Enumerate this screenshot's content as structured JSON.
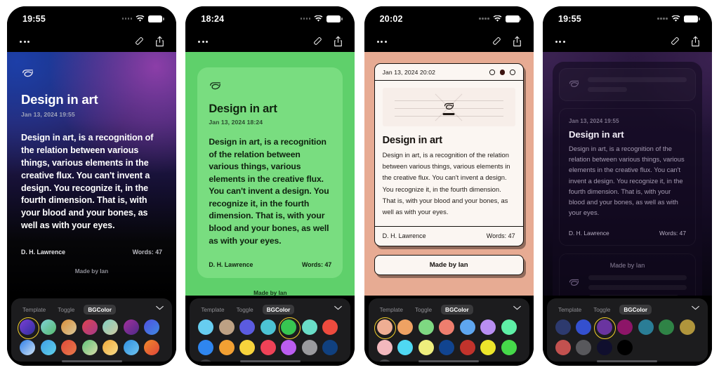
{
  "app": {
    "note_title": "Design in art",
    "author": "D. H. Lawrence",
    "words": "Words: 47",
    "made_by": "Made by Ian",
    "body_text": "Design in art, is a recognition of the relation between various things, various elements in the creative flux. You can't invent a design. You recognize it, in the fourth dimension. That is, with your blood and your bones, as well as with your eyes.",
    "leaf_icon": "leaf-icon",
    "more_icon": "more-icon",
    "eraser_icon": "eraser-icon",
    "share_icon": "share-icon",
    "wifi_icon": "wifi-icon",
    "battery_icon": "battery-icon",
    "signal_icon": "signal-icon",
    "chevron_icon": "chevron-down-icon"
  },
  "panel": {
    "tab_template": "Template",
    "tab_toggle": "Toggle",
    "tab_bgcolor": "BGColor",
    "active_tab": "BGColor",
    "selection_ring_color": "#f3d02b"
  },
  "phones": [
    {
      "id": "phone-gradient",
      "time": "19:55",
      "date": "Jan 13, 2024 19:55",
      "style": "gradient",
      "bg_accent": "#2b2060",
      "swatches": [
        {
          "name": "purple-blue-gradient",
          "css": "linear-gradient(135deg,#7a3fd4,#2f2f9e)",
          "selected": true
        },
        {
          "name": "teal-green-gradient",
          "css": "linear-gradient(135deg,#7fd3d8,#58b96e)",
          "selected": false
        },
        {
          "name": "orange-tan-gradient",
          "css": "linear-gradient(135deg,#d98f3a,#d9c79a)",
          "selected": false
        },
        {
          "name": "red-pink-gradient",
          "css": "linear-gradient(135deg,#e0434f,#a43a8a)",
          "selected": false
        },
        {
          "name": "mint-sand-gradient",
          "css": "linear-gradient(135deg,#7fcfc3,#cfc9a0)",
          "selected": false
        },
        {
          "name": "magenta-purple-gradient",
          "css": "linear-gradient(135deg,#a4309b,#4d2a8a)",
          "selected": false
        },
        {
          "name": "indigo-blue-gradient",
          "css": "linear-gradient(135deg,#4f4fe0,#3f8ae0)",
          "selected": false
        },
        {
          "name": "blue-white-gradient",
          "css": "linear-gradient(135deg,#2f7fe8,#cfe3f5)",
          "selected": false
        },
        {
          "name": "sky-blue-gradient",
          "css": "linear-gradient(135deg,#3f9fe8,#5fd0e8)",
          "selected": false
        },
        {
          "name": "red-orange-gradient",
          "css": "linear-gradient(135deg,#e04a3a,#e87a4a)",
          "selected": false
        },
        {
          "name": "green-cream-gradient",
          "css": "linear-gradient(135deg,#5fc27a,#d8dba8)",
          "selected": false
        },
        {
          "name": "yellow-gradient",
          "css": "linear-gradient(135deg,#f0a83a,#f7dc8a)",
          "selected": false
        },
        {
          "name": "azure-gradient",
          "css": "linear-gradient(135deg,#2f8fe0,#6fc4ef)",
          "selected": false
        },
        {
          "name": "orange-red-gradient",
          "css": "linear-gradient(135deg,#f08a2a,#e0453a)",
          "selected": false
        }
      ]
    },
    {
      "id": "phone-green",
      "time": "18:24",
      "date": "Jan 13, 2024 18:24",
      "style": "green-card",
      "bg_accent": "#5fd06b",
      "swatches": [
        {
          "name": "light-blue",
          "css": "#67cdf0",
          "selected": false
        },
        {
          "name": "tan",
          "css": "#bda184",
          "selected": false
        },
        {
          "name": "indigo",
          "css": "#5b5be0",
          "selected": false
        },
        {
          "name": "teal",
          "css": "#4cc3d4",
          "selected": false
        },
        {
          "name": "green",
          "css": "#37c652",
          "selected": true
        },
        {
          "name": "aquamarine",
          "css": "#69ddc7",
          "selected": false
        },
        {
          "name": "red",
          "css": "#ee4b3e",
          "selected": false
        },
        {
          "name": "blue",
          "css": "#2f86ef",
          "selected": false
        },
        {
          "name": "orange",
          "css": "#f2a033",
          "selected": false
        },
        {
          "name": "yellow",
          "css": "#f7d33c",
          "selected": false
        },
        {
          "name": "crimson",
          "css": "#ef4257",
          "selected": false
        },
        {
          "name": "violet",
          "css": "#bb5df0",
          "selected": false
        },
        {
          "name": "gray",
          "css": "#9a9a9e",
          "selected": false
        },
        {
          "name": "navy",
          "css": "#10407f",
          "selected": false
        },
        {
          "name": "dark-gray",
          "css": "#3e3e42",
          "selected": false
        }
      ]
    },
    {
      "id": "phone-paper",
      "time": "20:02",
      "date": "Jan 13, 2024 20:02",
      "style": "paper-card",
      "bg_accent": "#e7ab93",
      "swatches": [
        {
          "name": "peach",
          "css": "#efae93",
          "selected": true
        },
        {
          "name": "light-orange",
          "css": "#efa263",
          "selected": false
        },
        {
          "name": "light-green",
          "css": "#7ed882",
          "selected": false
        },
        {
          "name": "salmon",
          "css": "#ef7e6e",
          "selected": false
        },
        {
          "name": "cornflower",
          "css": "#5ea6ef",
          "selected": false
        },
        {
          "name": "lavender",
          "css": "#b98ef2",
          "selected": false
        },
        {
          "name": "spring-green",
          "css": "#5eefa6",
          "selected": false
        },
        {
          "name": "pink",
          "css": "#f2b8bd",
          "selected": false
        },
        {
          "name": "cyan",
          "css": "#4fd8f2",
          "selected": false
        },
        {
          "name": "pale-yellow",
          "css": "#eeee7d",
          "selected": false
        },
        {
          "name": "deep-blue",
          "css": "#11448f",
          "selected": false
        },
        {
          "name": "brick-red",
          "css": "#c2332c",
          "selected": false
        },
        {
          "name": "bright-yellow",
          "css": "#ece52b",
          "selected": false
        },
        {
          "name": "grass-green",
          "css": "#46d94a",
          "selected": false
        },
        {
          "name": "charcoal",
          "css": "#4b4b4d",
          "selected": false
        }
      ]
    },
    {
      "id": "phone-dark-purple",
      "time": "19:55",
      "date": "Jan 13, 2024 19:55",
      "style": "dark-skeleton",
      "bg_accent": "#2a1840",
      "swatches": [
        {
          "name": "dark-navy",
          "css": "#2d3a6e",
          "selected": false
        },
        {
          "name": "royal-blue",
          "css": "#3450cf",
          "selected": false
        },
        {
          "name": "purple",
          "css": "#6a34a0",
          "selected": true
        },
        {
          "name": "magenta",
          "css": "#8d1568",
          "selected": false
        },
        {
          "name": "teal-dark",
          "css": "#2a7d96",
          "selected": false
        },
        {
          "name": "forest-green",
          "css": "#2f8346",
          "selected": false
        },
        {
          "name": "dark-gold",
          "css": "#b0953c",
          "selected": false
        },
        {
          "name": "dusty-red",
          "css": "#c2514f",
          "selected": false
        },
        {
          "name": "gray",
          "css": "#58585c",
          "selected": false
        },
        {
          "name": "midnight",
          "css": "#100f2e",
          "selected": false
        },
        {
          "name": "black",
          "css": "#000000",
          "selected": false
        }
      ]
    }
  ]
}
